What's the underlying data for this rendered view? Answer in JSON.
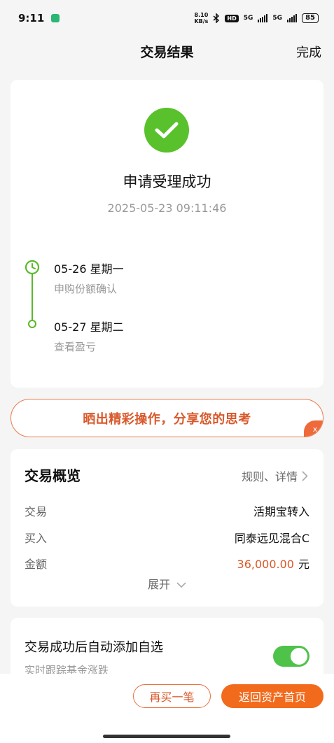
{
  "status_bar": {
    "time": "9:11",
    "net_speed_value": "8.10",
    "net_speed_unit": "KB/s",
    "hd": "HD",
    "sim1": "5G",
    "sim2": "5G",
    "battery": "85"
  },
  "header": {
    "title": "交易结果",
    "done_label": "完成"
  },
  "result": {
    "title": "申请受理成功",
    "time": "2025-05-23 09:11:46",
    "icon": "check-circle-icon",
    "accent_color": "#59c12c"
  },
  "timeline": [
    {
      "date": "05-26  星期一",
      "desc": "申购份额确认"
    },
    {
      "date": "05-27  星期二",
      "desc": "查看盈亏"
    }
  ],
  "share": {
    "text": "晒出精彩操作，分享您的思考",
    "close": "x"
  },
  "overview": {
    "title": "交易概览",
    "link": "规则、详情",
    "rows": [
      {
        "key": "交易",
        "value": "活期宝转入"
      },
      {
        "key": "买入",
        "value": "同泰远见混合C"
      },
      {
        "key": "金额",
        "value": "36,000.00",
        "unit": "元"
      }
    ],
    "expand": "展开"
  },
  "auto_add": {
    "title": "交易成功后自动添加自选",
    "subtitle": "实时跟踪基金涨跌",
    "enabled": true
  },
  "buttons": {
    "rebuy": "再买一笔",
    "home": "返回资产首页",
    "brand_color": "#f26a1b"
  }
}
